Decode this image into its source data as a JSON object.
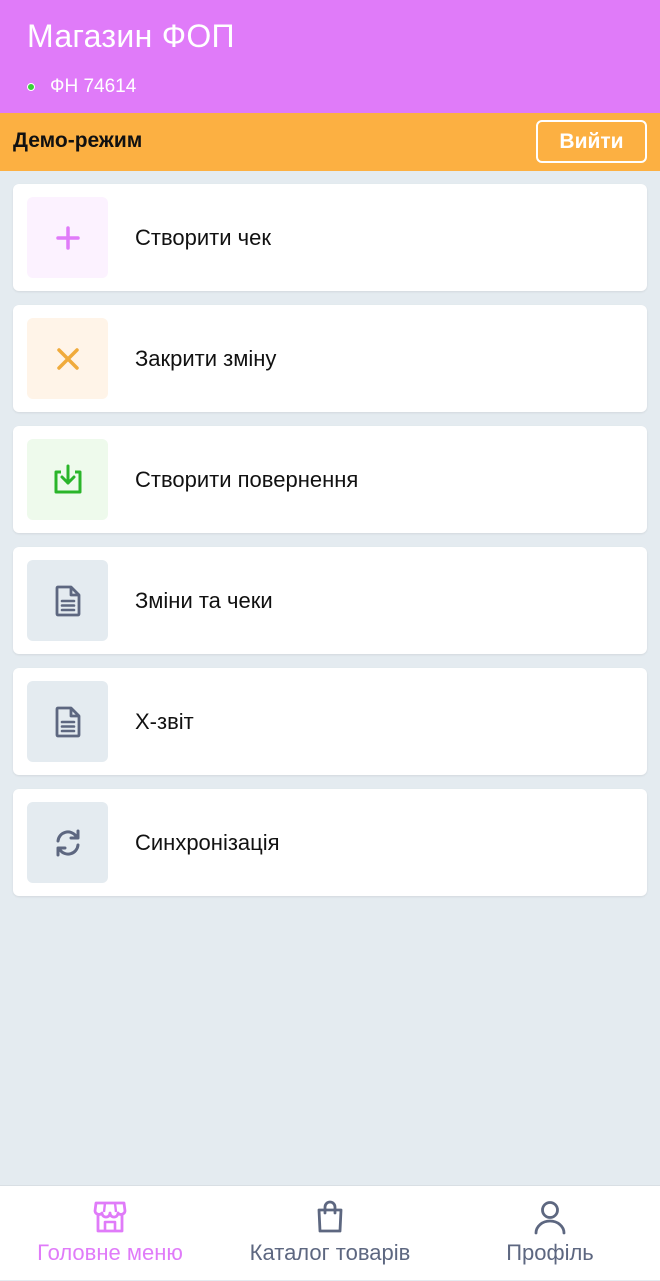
{
  "header": {
    "title": "Магазин ФОП",
    "fiscal_number": "ФН 74614",
    "status_color": "#3ad13a",
    "background_color": "#e07bf9"
  },
  "demo_bar": {
    "label": "Демо-режим",
    "exit_label": "Вийти",
    "background_color": "#fcb042"
  },
  "menu": {
    "items": [
      {
        "label": "Створити чек",
        "icon": "plus-icon",
        "icon_color": "#e07bf9",
        "icon_bg": "#fcf2ff"
      },
      {
        "label": "Закрити зміну",
        "icon": "close-icon",
        "icon_color": "#f0ab3c",
        "icon_bg": "#fff4e8"
      },
      {
        "label": "Створити повернення",
        "icon": "download-icon",
        "icon_color": "#2ab52a",
        "icon_bg": "#eefaec"
      },
      {
        "label": "Зміни та чеки",
        "icon": "document-icon",
        "icon_color": "#5d6780",
        "icon_bg": "#e4ebf0"
      },
      {
        "label": "X-звіт",
        "icon": "document-icon",
        "icon_color": "#5d6780",
        "icon_bg": "#e4ebf0"
      },
      {
        "label": "Синхронізація",
        "icon": "sync-icon",
        "icon_color": "#5d6780",
        "icon_bg": "#e4ebf0"
      }
    ]
  },
  "bottom_nav": {
    "items": [
      {
        "label": "Головне меню",
        "icon": "store-icon",
        "active": true
      },
      {
        "label": "Каталог товарів",
        "icon": "shopping-bag-icon",
        "active": false
      },
      {
        "label": "Профіль",
        "icon": "user-icon",
        "active": false
      }
    ],
    "active_color": "#e07bf9",
    "inactive_color": "#5d6780"
  }
}
